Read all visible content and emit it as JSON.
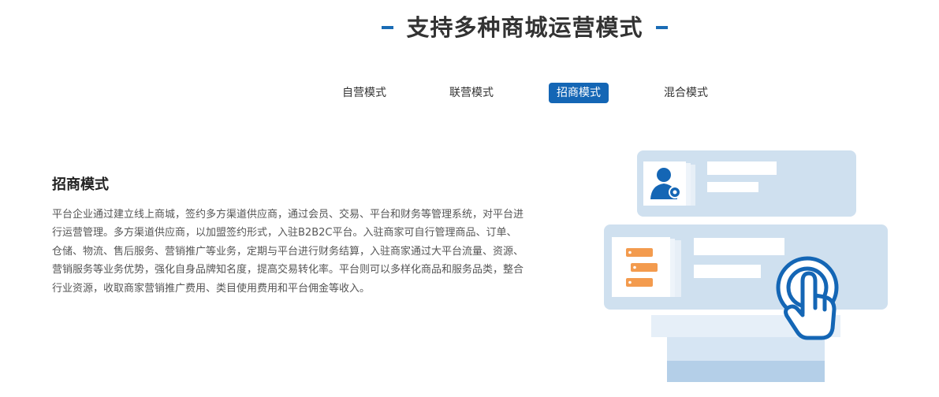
{
  "heading": {
    "title": "支持多种商城运营模式"
  },
  "tabs": [
    {
      "label": "自营模式",
      "active": false
    },
    {
      "label": "联营模式",
      "active": false
    },
    {
      "label": "招商模式",
      "active": true
    },
    {
      "label": "混合模式",
      "active": false
    }
  ],
  "content": {
    "title": "招商模式",
    "description": "平台企业通过建立线上商城，签约多方渠道供应商，通过会员、交易、平台和财务等管理系统，对平台进行运营管理。多方渠道供应商，以加盟签约形式，入驻B2B2C平台。入驻商家可自行管理商品、订单、仓储、物流、售后服务、营销推广等业务，定期与平台进行财务结算，入驻商家通过大平台流量、资源、营销服务等业务优势，强化自身品牌知名度，提高交易转化率。平台则可以多样化商品和服务品类，整合行业资源，收取商家营销推广费用、类目使用费用和平台佣金等收入。"
  },
  "colors": {
    "accent": "#1466b5",
    "card": "#cfe0ef",
    "orange": "#f39b4e"
  }
}
